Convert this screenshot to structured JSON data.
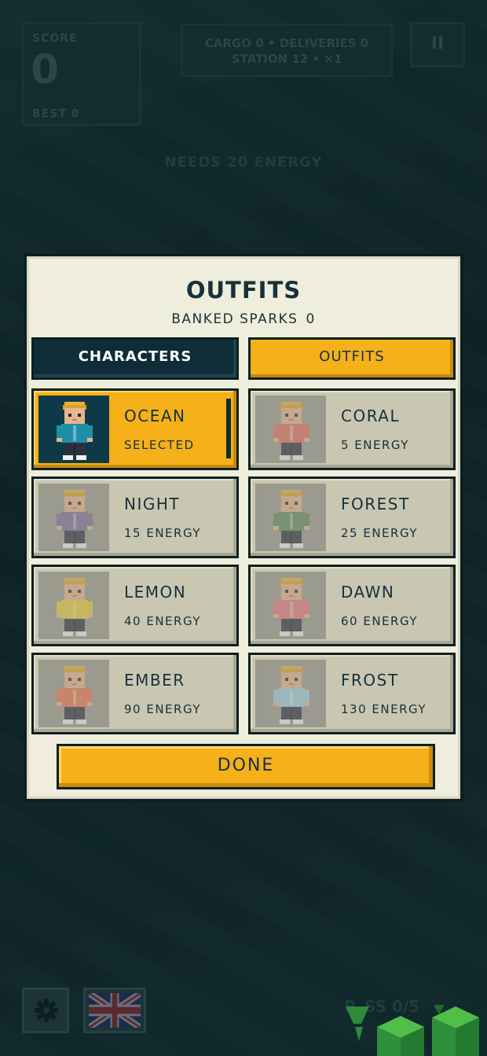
{
  "hud": {
    "score_label": "SCORE",
    "score_value": "0",
    "best_label": "BEST  0",
    "cargo_line": "CARGO 0  •  DELIVERIES 0",
    "station_line": "STATION 12  •  ×1",
    "pause_symbol": "II",
    "needs_energy": "NEEDS 20 ENERGY",
    "bottom_text": "P..SS 0/5",
    "settings_icon": "gear-icon",
    "language_icon": "uk-flag-icon"
  },
  "modal": {
    "title": "OUTFITS",
    "banked_label": "BANKED SPARKS",
    "banked_value": "0",
    "tabs": [
      {
        "label": "CHARACTERS",
        "active": false
      },
      {
        "label": "OUTFITS",
        "active": true
      }
    ],
    "outfits": [
      {
        "name": "OCEAN",
        "status": "SELECTED",
        "shirt": "#1f8fa8",
        "selected": true
      },
      {
        "name": "CORAL",
        "status": "5 ENERGY",
        "shirt": "#e0705f",
        "selected": false
      },
      {
        "name": "NIGHT",
        "status": "15 ENERGY",
        "shirt": "#7a6f9a",
        "selected": false
      },
      {
        "name": "FOREST",
        "status": "25 ENERGY",
        "shirt": "#5f8a5a",
        "selected": false
      },
      {
        "name": "LEMON",
        "status": "40 ENERGY",
        "shirt": "#e6cf3a",
        "selected": false
      },
      {
        "name": "DAWN",
        "status": "60 ENERGY",
        "shirt": "#e8787c",
        "selected": false
      },
      {
        "name": "EMBER",
        "status": "90 ENERGY",
        "shirt": "#ec7752",
        "selected": false
      },
      {
        "name": "FROST",
        "status": "130 ENERGY",
        "shirt": "#9ecde0",
        "selected": false
      }
    ],
    "done_label": "DONE"
  },
  "colors": {
    "accent": "#f5b01a",
    "panel": "#efeddb",
    "dark": "#0e2d36",
    "locked_card": "#c9c6b2"
  }
}
